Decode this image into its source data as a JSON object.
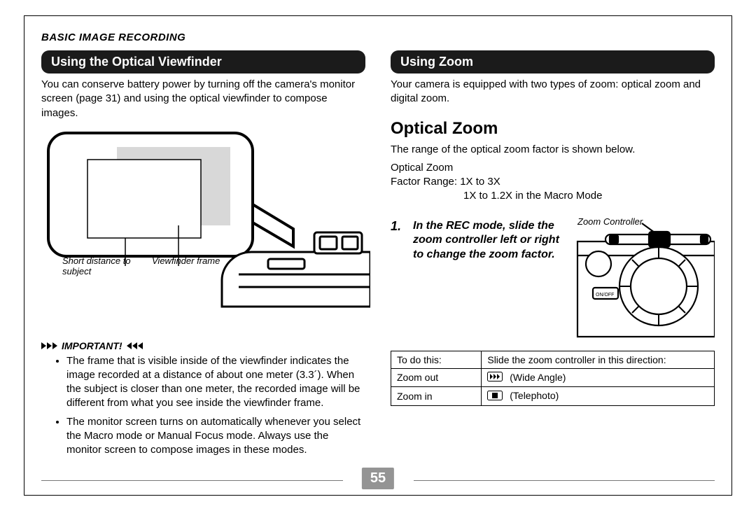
{
  "header": "BASIC IMAGE RECORDING",
  "pagenum": "55",
  "left": {
    "pill": "Using the Optical Viewfinder",
    "para": "You can conserve battery power by turning off the camera's monitor screen (page 31) and using the optical viewfinder to compose images.",
    "fig": {
      "label1": "Short distance to subject",
      "label2": "Viewfinder frame"
    },
    "important_label": "IMPORTANT!",
    "important": [
      "The frame that is visible inside of the viewfinder indicates the image recorded at a distance of about one meter (3.3´). When the subject is closer than one meter, the recorded image will be different from what you see inside the viewfinder frame.",
      "The monitor screen turns on automatically whenever you select the Macro mode or Manual Focus mode. Always use the monitor screen to compose images in these modes."
    ]
  },
  "right": {
    "pill": "Using Zoom",
    "para": "Your camera is equipped with two types of zoom: optical zoom and digital zoom.",
    "h2": "Optical Zoom",
    "range_intro": "The range of the optical zoom factor is shown below.",
    "spec": {
      "l1": "Optical Zoom",
      "l2": "Factor Range:  1X to 3X",
      "l3": "1X to 1.2X in the Macro Mode"
    },
    "step": {
      "num": "1.",
      "text": "In the REC mode, slide the zoom controller left or right to change the zoom factor.",
      "figcap": "Zoom Controller"
    },
    "table": {
      "h1": "To do this:",
      "h2": "Slide the zoom controller in this direction:",
      "r1c1": "Zoom out",
      "r1c2": "(Wide Angle)",
      "r2c1": "Zoom in",
      "r2c2": "(Telephoto)"
    }
  }
}
